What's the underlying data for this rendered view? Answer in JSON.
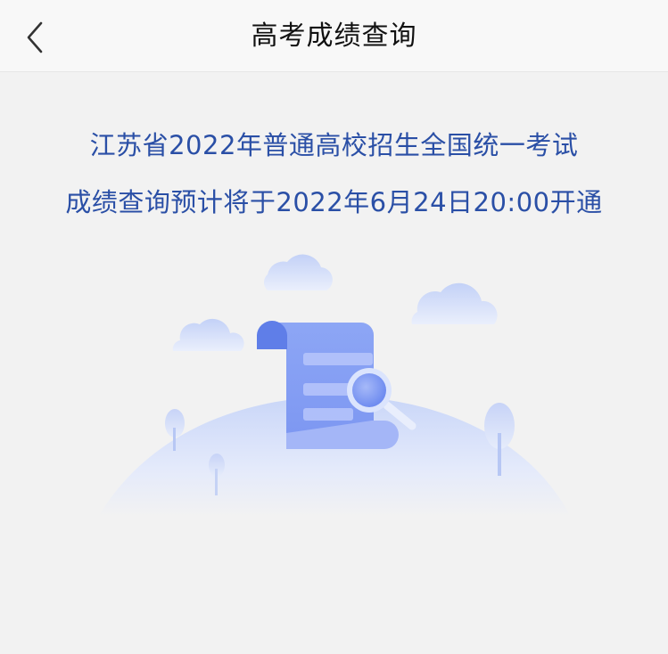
{
  "header": {
    "title": "高考成绩查询",
    "back_icon": "chevron-left-icon"
  },
  "notice": {
    "line1": "江苏省2022年普通高校招生全国统一考试",
    "line2": "成绩查询预计将于2022年6月24日20:00开通"
  },
  "illustration": {
    "icons": [
      "cloud-icon",
      "scroll-document-icon",
      "magnifier-icon",
      "tree-icon",
      "hill-icon"
    ]
  },
  "colors": {
    "notice_text": "#2a4fa6",
    "background": "#f2f2f2",
    "accent": "#6c8df0"
  }
}
